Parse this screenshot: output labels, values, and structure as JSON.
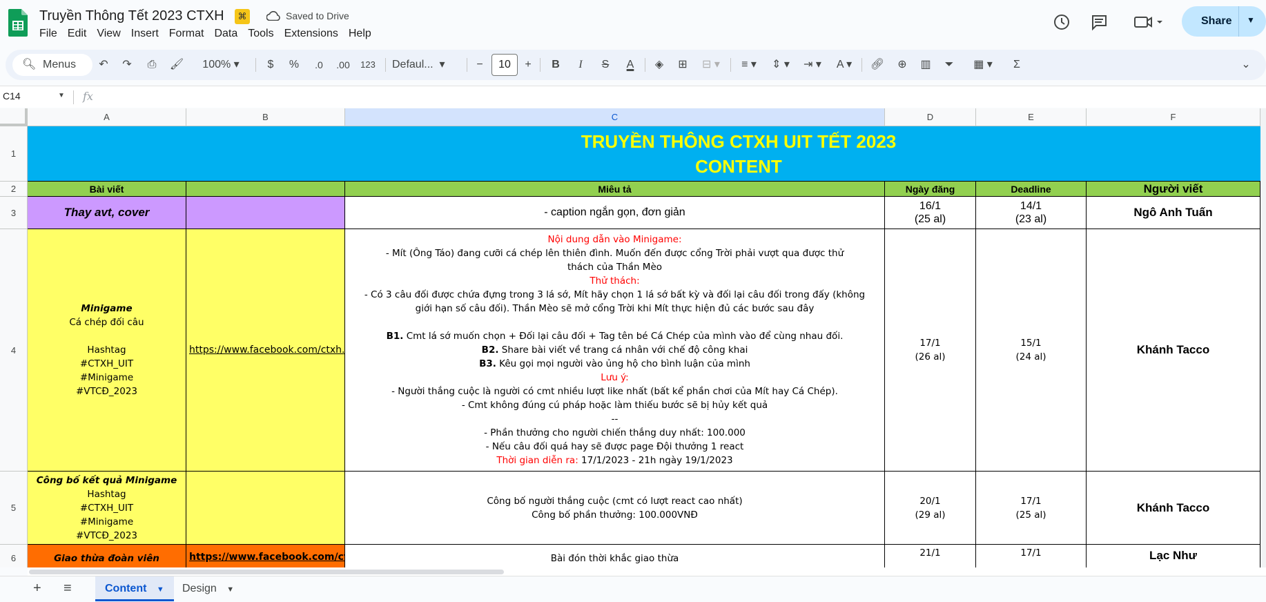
{
  "app": {
    "doc_title": "Truyền Thông Tết 2023 CTXH",
    "saved_status": "Saved to Drive",
    "share_label": "Share",
    "menu": [
      "File",
      "Edit",
      "View",
      "Insert",
      "Format",
      "Data",
      "Tools",
      "Extensions",
      "Help"
    ],
    "icons": [
      "history-icon",
      "comment-icon",
      "meet-icon"
    ]
  },
  "toolbar": {
    "search_label": "Menus",
    "zoom": "100%",
    "currency": "$",
    "percent": "%",
    "dec_decrease": ".0",
    "dec_increase": ".00",
    "number_format": "123",
    "font": "Defaul...",
    "font_size": "10",
    "minus": "−",
    "plus": "+",
    "bold": "B",
    "italic": "I",
    "strike": "S",
    "text_color": "A",
    "sum": "Σ"
  },
  "formula_bar": {
    "name_box": "C14",
    "fx": "fx",
    "value": ""
  },
  "columns": [
    "A",
    "B",
    "C",
    "D",
    "E",
    "F"
  ],
  "rows": [
    "1",
    "2",
    "3",
    "4",
    "5",
    "6"
  ],
  "sheet": {
    "banner_line1": "TRUYỀN THÔNG CTXH UIT TẾT 2023",
    "banner_line2": "CONTENT",
    "headers": {
      "a": "Bài viết",
      "b": "",
      "c": "Miêu tả",
      "d": "Ngày đăng",
      "e": "Deadline",
      "f": "Người viết"
    },
    "row3": {
      "a": "Thay avt, cover",
      "c": "- caption ngắn gọn, đơn giản",
      "d1": "16/1",
      "d2": "(25 al)",
      "e1": "14/1",
      "e2": "(23 al)",
      "f": "Ngô Anh Tuấn"
    },
    "row4": {
      "a_title": "Minigame",
      "a_sub": "Cá chép đối câu",
      "a_tags": [
        "Hashtag",
        "#CTXH_UIT",
        "#Minigame",
        "#VTCĐ_2023"
      ],
      "b": "https://www.facebook.com/ctxh.uit",
      "c_heading1": "Nội dung dẫn vào Minigame:",
      "c_line1": "- Mít (Ông Táo) đang cưỡi cá chép lên thiên đình. Muốn đến được cổng Trời phải vượt qua được thử",
      "c_line2": "thách của Thần Mèo",
      "c_heading2": "Thử thách:",
      "c_line3": "- Có 3 câu đối được chứa đựng trong 3 lá sớ, Mít hãy chọn 1 lá sớ bất kỳ và đối lại câu đối trong đấy (không",
      "c_line4": "giới hạn số câu đối). Thần Mèo sẽ mở cổng Trời khi Mít thực hiện đủ các bước sau đây",
      "b1_label": "B1.",
      "b1_text": " Cmt lá sớ muốn chọn + Đối lại câu đối + Tag tên bé Cá Chép của mình vào để cùng nhau đối.",
      "b2_label": "B2.",
      "b2_text": " Share bài viết về trang cá nhân với chế độ công khai",
      "b3_label": "B3.",
      "b3_text": " Kêu gọi mọi người vào ủng hộ cho bình luận của mình",
      "c_heading3": "Lưu ý:",
      "c_line5": "- Người thắng cuộc là người có cmt nhiều lượt like nhất (bất kể phần chơi của Mít hay Cá Chép).",
      "c_line6": "- Cmt không đúng cú pháp hoặc làm thiếu bước sẽ bị hủy kết quả",
      "c_line7": "--",
      "c_line8": "- Phần thưởng cho người chiến thắng duy nhất: 100.000",
      "c_line9": "- Nếu câu đối quá hay sẽ được page Đội thưởng 1 react",
      "c_time_label": "Thời gian diễn ra:",
      "c_time_value": " 17/1/2023 - 21h ngày 19/1/2023",
      "d1": "17/1",
      "d2": "(26 al)",
      "e1": "15/1",
      "e2": "(24 al)",
      "f": "Khánh Tacco"
    },
    "row5": {
      "a_title": "Công bố kết quả Minigame",
      "a_tags": [
        "Hashtag",
        "#CTXH_UIT",
        "#Minigame",
        "#VTCĐ_2023"
      ],
      "c1": "Công bố người thắng cuộc (cmt có lượt react cao nhất)",
      "c2": "Công bố phần thưởng: 100.000VNĐ",
      "d1": "20/1",
      "d2": "(29 al)",
      "e1": "17/1",
      "e2": "(25 al)",
      "f": "Khánh Tacco"
    },
    "row6": {
      "a": "Giao thừa đoàn viên",
      "b": "https://www.facebook.com/ctxh",
      "c": "Bài đón thời khắc giao thừa",
      "d1": "21/1",
      "e1": "17/1",
      "f": "Lạc Như"
    }
  },
  "sheets": {
    "active": "Content",
    "other": "Design"
  },
  "colors": {
    "banner_bg": "#00b0f0",
    "banner_text": "#ffff00",
    "header_bg": "#92d050",
    "row3_a_bg": "#cc99ff",
    "row4_ab_bg": "#ffff66",
    "row6_ab_bg": "#ff6d01",
    "accent": "#0b57d0"
  }
}
